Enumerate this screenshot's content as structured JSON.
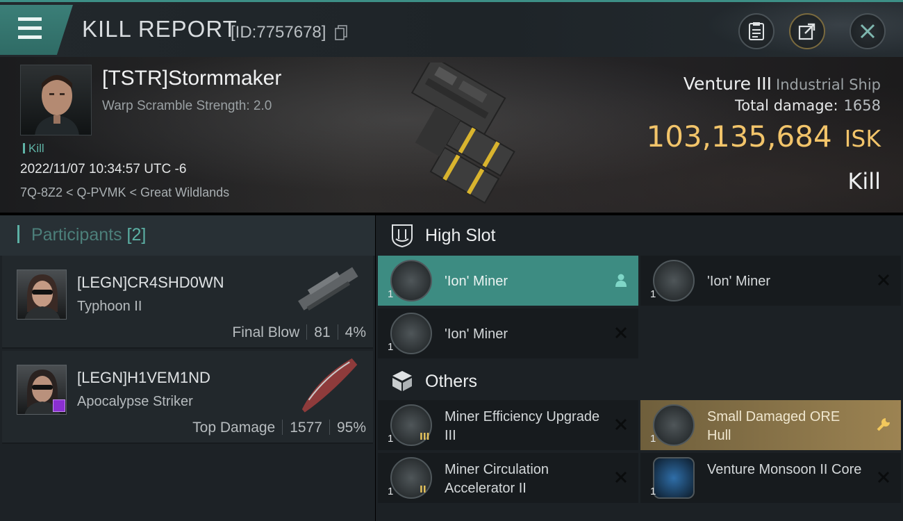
{
  "header": {
    "title": "KILL REPORT",
    "report_id": "[ID:7757678]"
  },
  "victim": {
    "name": "[TSTR]Stormmaker",
    "warp_scramble": "Warp Scramble Strength: 2.0",
    "kill_tag": "Kill",
    "datetime": "2022/11/07 10:34:57 UTC -6",
    "location": "7Q-8Z2 < Q-PVMK < Great Wildlands",
    "ship_name": "Venture III",
    "ship_class": "Industrial Ship",
    "total_damage_label": "Total damage:",
    "total_damage_value": "1658",
    "isk_value": "103,135,684",
    "isk_unit": "ISK",
    "result": "Kill"
  },
  "participants": {
    "title": "Participants",
    "count": "[2]",
    "items": [
      {
        "name": "[LEGN]CR4SHD0WN",
        "ship": "Typhoon II",
        "role": "Final Blow",
        "damage": "81",
        "percent": "4%"
      },
      {
        "name": "[LEGN]H1VEM1ND",
        "ship": "Apocalypse Striker",
        "role": "Top Damage",
        "damage": "1577",
        "percent": "95%"
      }
    ]
  },
  "high_slot": {
    "title": "High Slot",
    "items": [
      {
        "qty": "1",
        "name": "'Ion' Miner"
      },
      {
        "qty": "1",
        "name": "'Ion' Miner"
      },
      {
        "qty": "1",
        "name": "'Ion' Miner"
      }
    ]
  },
  "others": {
    "title": "Others",
    "items": [
      {
        "qty": "1",
        "name": "Miner Efficiency Upgrade III",
        "meta": "III"
      },
      {
        "qty": "1",
        "name": "Small Damaged ORE Hull"
      },
      {
        "qty": "1",
        "name": "Miner Circulation Accelerator II",
        "meta": "II"
      },
      {
        "qty": "1",
        "name": "Venture Monsoon II Core"
      }
    ]
  },
  "colors": {
    "accent_teal": "#3d8c82",
    "isk_gold": "#f2c46a",
    "salvage_gold": "#9c8352"
  }
}
